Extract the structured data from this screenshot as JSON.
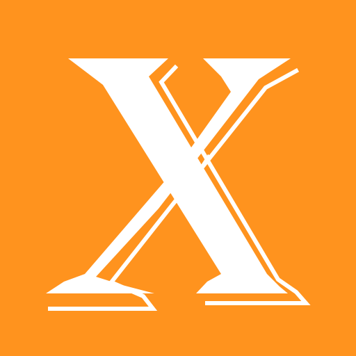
{
  "icon": {
    "letter": "X",
    "name": "x-letter-logo-icon",
    "colors": {
      "background": "#ff931e",
      "glyph": "#ffffff"
    }
  }
}
